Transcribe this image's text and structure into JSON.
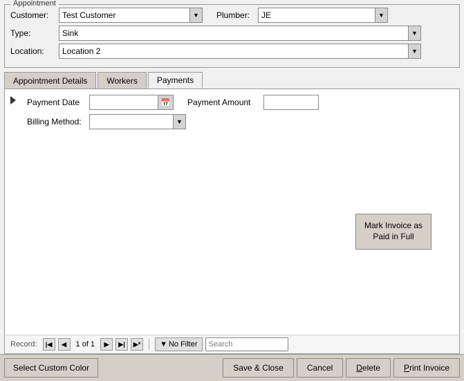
{
  "appointment": {
    "legend": "Appointment",
    "customer_label": "Customer:",
    "customer_value": "Test Customer",
    "plumber_label": "Plumber:",
    "plumber_value": "JE",
    "type_label": "Type:",
    "type_value": "Sink",
    "location_label": "Location:",
    "location_value": "Location 2"
  },
  "tabs": {
    "items": [
      {
        "id": "appointment-details",
        "label": "Appointment Details"
      },
      {
        "id": "workers",
        "label": "Workers"
      },
      {
        "id": "payments",
        "label": "Payments"
      }
    ],
    "active": "payments"
  },
  "payments": {
    "payment_date_label": "Payment Date",
    "payment_date_value": "",
    "payment_amount_label": "Payment Amount",
    "payment_amount_value": "",
    "billing_method_label": "Billing Method:",
    "billing_method_value": "",
    "mark_invoice_label": "Mark Invoice as Paid in Full"
  },
  "record_nav": {
    "label": "Record:",
    "first_icon": "◀◀",
    "prev_icon": "◀",
    "record_text": "1 of 1",
    "next_icon": "▶",
    "last_icon": "▶▶",
    "new_icon": "▶*",
    "no_filter_label": "No Filter",
    "search_placeholder": "Search"
  },
  "toolbar": {
    "select_color_label": "Select Custom Color",
    "save_close_label": "Save & Close",
    "cancel_label": "Cancel",
    "delete_label": "Delete",
    "print_invoice_label": "Print Invoice",
    "delete_underline": "D",
    "print_underline": "P"
  }
}
